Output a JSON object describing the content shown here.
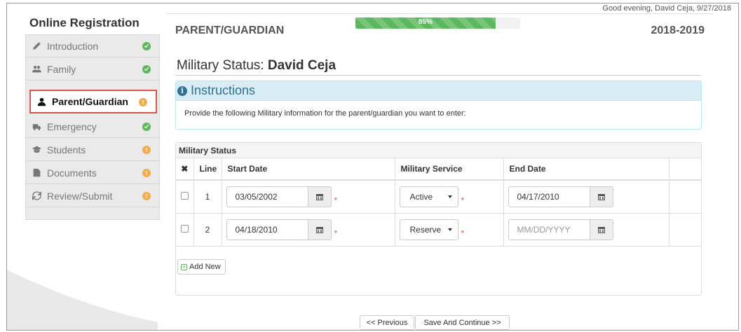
{
  "greeting": "Good evening, David Ceja, 9/27/2018",
  "header": {
    "section": "PARENT/GUARDIAN",
    "year": "2018-2019",
    "progress": {
      "label": "85%",
      "value": 0.85
    }
  },
  "sidebar": {
    "title": "Online Registration",
    "items": [
      {
        "label": "Introduction",
        "icon": "pencil-icon",
        "status": "complete",
        "active": false
      },
      {
        "label": "Family",
        "icon": "users-icon",
        "status": "complete",
        "active": false
      },
      {
        "label": "Parent/Guardian",
        "icon": "user-icon",
        "status": "pending",
        "active": true
      },
      {
        "label": "Emergency",
        "icon": "ambulance-icon",
        "status": "complete",
        "active": false
      },
      {
        "label": "Students",
        "icon": "graduation-cap-icon",
        "status": "pending",
        "active": false
      },
      {
        "label": "Documents",
        "icon": "file-icon",
        "status": "pending",
        "active": false
      },
      {
        "label": "Review/Submit",
        "icon": "refresh-icon",
        "status": "pending",
        "active": false
      }
    ]
  },
  "page": {
    "title_prefix": "Military Status:",
    "title_name": "David Ceja"
  },
  "instructions": {
    "title": "Instructions",
    "text": "Provide the following Military information for the parent/guardian you want to enter:"
  },
  "military": {
    "panel_title": "Military Status",
    "columns": {
      "delete": "✖",
      "line": "Line",
      "start": "Start Date",
      "service": "Military Service",
      "end": "End Date"
    },
    "rows": [
      {
        "line": "1",
        "start_date": "03/05/2002",
        "service": "Active",
        "end_date": "04/17/2010",
        "end_placeholder": ""
      },
      {
        "line": "2",
        "start_date": "04/18/2010",
        "service": "Reserve",
        "end_date": "",
        "end_placeholder": "MM/DD/YYYY"
      }
    ],
    "required_mark": "*",
    "add_new_label": "Add New"
  },
  "footer": {
    "previous_label": "<< Previous",
    "next_label": "Save And Continue >>"
  },
  "colors": {
    "accent_red": "#d9534f",
    "success": "#5cb85c",
    "warning": "#f0ad4e",
    "info": "#31708f"
  }
}
